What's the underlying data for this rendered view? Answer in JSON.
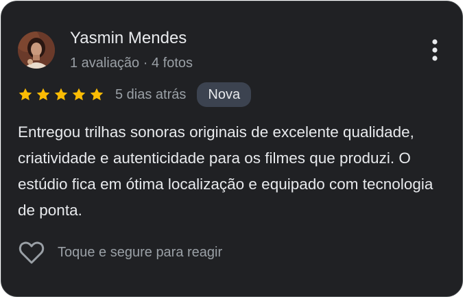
{
  "review": {
    "author_name": "Yasmin Mendes",
    "author_meta": "1 avaliação · 4 fotos",
    "rating": 5,
    "rating_max": 5,
    "date": "5 dias atrás",
    "badge": "Nova",
    "text": "Entregou trilhas sonoras originais de excelente qualidade, criatividade e autenticidade para os filmes que produzi. O estúdio fica em ótima localização e equipado com tecnologia de ponta."
  },
  "reaction": {
    "label": "Toque e segure para reagir",
    "icon": "heart-outline-icon"
  },
  "menu": {
    "icon": "more-vert-icon"
  },
  "colors": {
    "card_background": "#202124",
    "star": "#fbbc04",
    "badge_background": "#3c4350",
    "primary_text": "#e8eaed",
    "secondary_text": "#9aa0a6"
  }
}
